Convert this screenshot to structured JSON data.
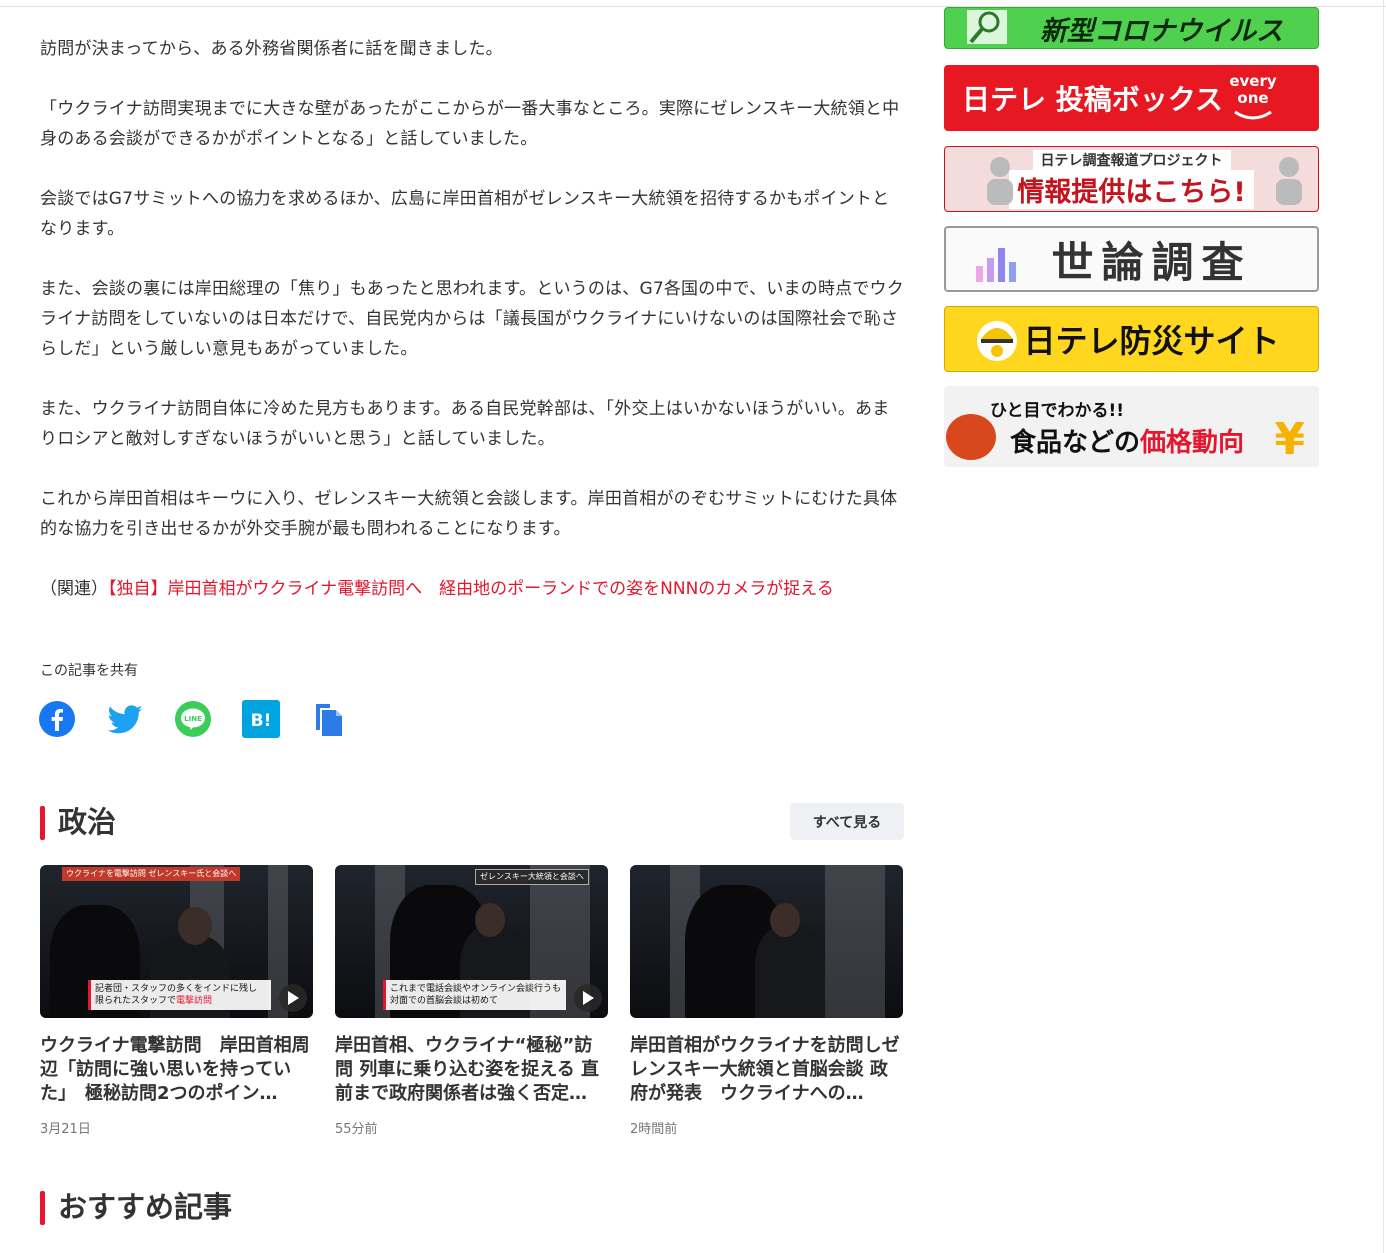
{
  "article": {
    "paragraphs": [
      "訪問が決まってから、ある外務省関係者に話を聞きました。",
      "「ウクライナ訪問実現までに大きな壁があったがここからが一番大事なところ。実際にゼレンスキー大統領と中身のある会談ができるかがポイントとなる」と話していました。",
      "会談ではG7サミットへの協力を求めるほか、広島に岸田首相がゼレンスキー大統領を招待するかもポイントとなります。",
      "また、会談の裏には岸田総理の「焦り」もあったと思われます。というのは、G7各国の中で、いまの時点でウクライナ訪問をしていないのは日本だけで、自民党内からは「議長国がウクライナにいけないのは国際社会で恥さらしだ」という厳しい意見もあがっていました。",
      "また、ウクライナ訪問自体に冷めた見方もあります。ある自民党幹部は、「外交上はいかないほうがいい。あまりロシアと敵対しすぎないほうがいいと思う」と話していました。",
      "これから岸田首相はキーウに入り、ゼレンスキー大統領と会談します。岸田首相がのぞむサミットにむけた具体的な協力を引き出せるかが外交手腕が最も問われることになります。"
    ],
    "related_prefix": "（関連）",
    "related_link": "【独自】岸田首相がウクライナ電撃訪問へ　経由地のポーランドでの姿をNNNのカメラが捉える"
  },
  "share": {
    "label": "この記事を共有",
    "icons": [
      "facebook-icon",
      "twitter-icon",
      "line-icon",
      "hatena-bookmark-icon",
      "copy-icon"
    ],
    "line_text": "LINE",
    "hatena_text": "B!"
  },
  "section_politics": {
    "title": "政治",
    "see_all": "すべて見る",
    "cards": [
      {
        "title": "ウクライナ電撃訪問　岸田首相周辺「訪問に強い思いを持っていた」　極秘訪問2つのポイン…",
        "time": "3月21日",
        "tag": "ウクライナを電撃訪問 ゼレンスキー氏と会談へ",
        "caption_line1": "記者団・スタッフの多くをインドに残し",
        "caption_line2a": "限られたスタッフで",
        "caption_line2b": "電撃訪問"
      },
      {
        "title": "岸田首相、ウクライナ“極秘”訪問 列車に乗り込む姿を捉える 直前まで政府関係者は強く否定…",
        "time": "55分前",
        "tag": "ゼレンスキー大統領と会談へ",
        "caption_line1": "これまで電話会談やオンライン会談行うも",
        "caption_line2a": "対面での首脳会談は初めて",
        "caption_line2b": ""
      },
      {
        "title": "岸田首相がウクライナを訪問しゼレンスキー大統領と首脳会談 政府が発表　ウクライナへの…",
        "time": "2時間前",
        "tag": "",
        "caption_line1": "",
        "caption_line2a": "",
        "caption_line2b": ""
      }
    ]
  },
  "section_recommended": {
    "title": "おすすめ記事"
  },
  "sidebar": {
    "banners": [
      {
        "label": "新型コロナウイルス"
      },
      {
        "label": "日テレ 投稿ボックス",
        "badge_top": "every",
        "badge_bottom": "one"
      },
      {
        "label_small": "日テレ調査報道プロジェクト",
        "label": "情報提供はこちら!"
      },
      {
        "label": "世論調査"
      },
      {
        "label": "日テレ防災サイト"
      },
      {
        "label_small": "ひと目でわかる!!",
        "label_a": "食品などの",
        "label_b": "価格動向",
        "symbol": "¥"
      }
    ]
  },
  "colors": {
    "accent": "#e5162d",
    "text": "#333333",
    "muted": "#777777"
  }
}
